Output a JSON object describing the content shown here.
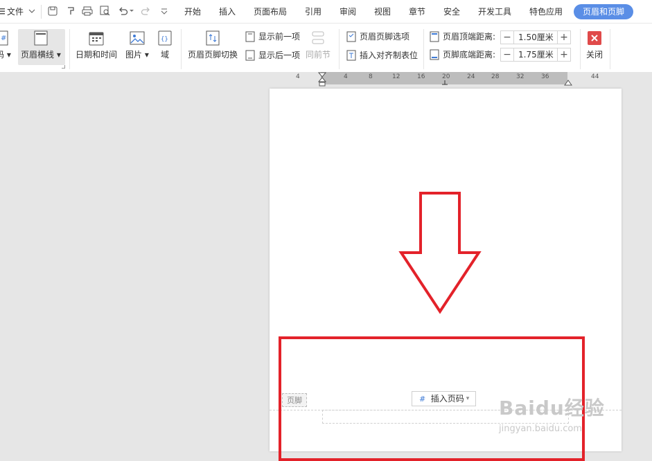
{
  "quick": {
    "file_label": "文件"
  },
  "tabs": [
    {
      "label": "开始"
    },
    {
      "label": "插入"
    },
    {
      "label": "页面布局"
    },
    {
      "label": "引用"
    },
    {
      "label": "审阅"
    },
    {
      "label": "视图"
    },
    {
      "label": "章节"
    },
    {
      "label": "安全"
    },
    {
      "label": "开发工具"
    },
    {
      "label": "特色应用"
    },
    {
      "label": "页眉和页脚"
    }
  ],
  "ribbon": {
    "page_number_partial": "码",
    "header_line": "页眉横线",
    "date_time": "日期和时间",
    "picture": "图片",
    "field": "域",
    "switch": "页眉页脚切换",
    "show_prev": "显示前一项",
    "show_next": "显示后一项",
    "same_as_prev": "同前节",
    "options": "页眉页脚选项",
    "insert_tab": "插入对齐制表位",
    "header_dist_label": "页眉顶端距离:",
    "header_dist_value": "1.50厘米",
    "footer_dist_label": "页脚底端距离:",
    "footer_dist_value": "1.75厘米",
    "close": "关闭"
  },
  "ruler": {
    "numbers": [
      "4",
      "4",
      "8",
      "12",
      "16",
      "20",
      "24",
      "28",
      "32",
      "36",
      "44"
    ]
  },
  "doc": {
    "footer_tag": "页脚",
    "insert_page_number": "插入页码"
  },
  "watermark": {
    "line1": "Baidu经验",
    "line2": "jingyan.baidu.com"
  },
  "colors": {
    "accent": "#5a8ee6",
    "annotation_red": "#e3222a",
    "close_red": "#e04a4a"
  }
}
